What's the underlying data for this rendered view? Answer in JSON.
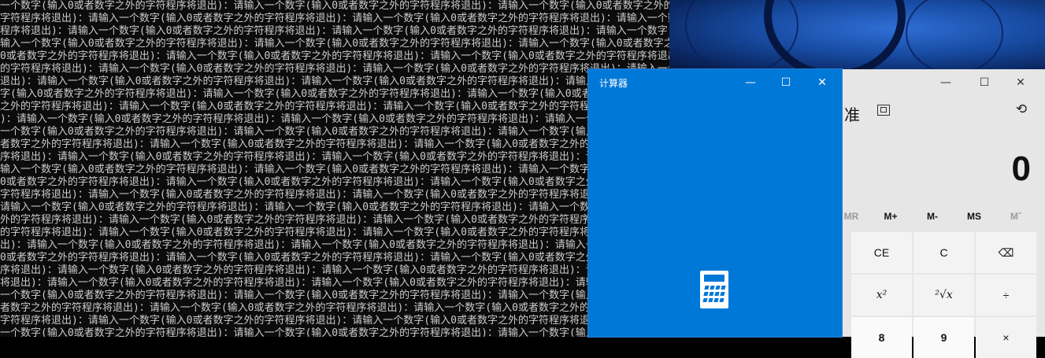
{
  "console": {
    "segment": "请输入一个数字(输入0或者数字之外的字符程序将退出)：",
    "lines": [
      "一个数字(输入0或者数字之外的字符程序将退出)：请输入一个数字(输入0或者数字之外的字符程序将退出)：请输入一个数字(输入0或者数字之外的字符程序将退出)：请",
      "字符程序将退出)：请输入一个数字(输入0或者数字之外的字符程序将退出)：请输入一个数字(输入0或者数字之外的字符程序将退出)：请输入一个数字(输入0或者",
      "程序将退出)：请输入一个数字(输入0或者数字之外的字符程序将退出)：请输入一个数字(输入0或者数字之外的字符程序将退出)：请输入一个数字(输入0或者数字之外的",
      "输入一个数字(输入0或者数字之外的字符程序将退出)：请输入一个数字(输入0或者数字之外的字符程序将退出)：请输入一个数字(输入0或者数字之外的字符程序将退出)：请",
      "0或者数字之外的字符程序将退出)：请输入一个数字(输入0或者数字之外的字符程序将退出)：请输入一个数字(输入0或者数字之外的字符程序将退出)：请输入一个数字(输",
      "的字符程序将退出)：请输入一个数字(输入0或者数字之外的字符程序将退出)：请输入一个数字(输入0或者数字之外的字符程序将退出)：请输入一个数字(输入0或者数字",
      "退出)：请输入一个数字(输入0或者数字之外的字符程序将退出)：请输入一个数字(输入0或者数字之外的字符程序将退出)：请输入一个数字(输入0或者数字之外的字",
      "字(输入0或者数字之外的字符程序将退出)：请输入一个数字(输入0或者数字之外的字符程序将退出)：请输入一个数字(输入0或者数字之外的字符程序将退出)：请输",
      "之外的字符程序将退出)：请输入一个数字(输入0或者数字之外的字符程序将退出)：请输入一个数字(输入0或者数字之外的字符程序将退出)：请输入一个数字(输入",
      ")：请输入一个数字(输入0或者数字之外的字符程序将退出)：请输入一个数字(输入0或者数字之外的字符程序将退出)：请输入一个数字(输入0或者数字之外的字",
      "一个数字(输入0或者数字之外的字符程序将退出)：请输入一个数字(输入0或者数字之外的字符程序将退出)：请输入一个数字(输入0或者数字之外的字符程序",
      "者数字之外的字符程序将退出)：请输入一个数字(输入0或者数字之外的字符程序将退出)：请输入一个数字(输入0或者数字之外的字符程序将退出)：请输入一",
      "序将退出)：请输入一个数字(输入0或者数字之外的字符程序将退出)：请输入一个数字(输入0或者数字之外的字符程序将退出)：请输入一个数字(输入0或者数",
      "输入一个数字(输入0或者数字之外的字符程序将退出)：请输入一个数字(输入0或者数字之外的字符程序将退出)：请输入一个数字(输入0或者数字之外的字符",
      "0或者数字之外的字符程序将退出)：请输入一个数字(输入0或者数字之外的字符程序将退出)：请输入一个数字(输入0或者数字之外的字符程序将退出)：请输入一",
      "字符程序将退出)：请输入一个数字(输入0或者数字之外的字符程序将退出)：请输入一个数字(输入0或者数字之外的字符程序将退出)：请输入一个数字(输入0或",
      "请输入一个数字(输入0或者数字之外的字符程序将退出)：请输入一个数字(输入0或者数字之外的字符程序将退出)：请输入一个数字(输入0或者数字之外的字符",
      "外的字符程序将退出)：请输入一个数字(输入0或者数字之外的字符程序将退出)：请输入一个数字(输入0或者数字之外的字符程序将退出)：请输入一个数",
      "的字符程序将退出)：请输入一个数字(输入0或者数字之外的字符程序将退出)：请输入一个数字(输入0或者数字之外的字符程序将退出)：请输入一个数字(输",
      "出)：请输入一个数字(输入0或者数字之外的字符程序将退出)：请输入一个数字(输入0或者数字之外的字符程序将退出)：请输入一个数字(输入0或者数字之外",
      "0或者数字之外的字符程序将退出)：请输入一个数字(输入0或者数字之外的字符程序将退出)：请输入一个数字(输入0或者数字之外的字符程序将退出)：请输入",
      "序将退出)：请输入一个数字(输入0或者数字之外的字符程序将退出)：请输入一个数字(输入0或者数字之外的字符程序将退出)：请输入一个数字(输入0或者数",
      "将退出)：请输入一个数字(输入0或者数字之外的字符程序将退出)：请输入一个数字(输入0或者数字之外的字符程序将退出)：请输入一个数字(输入0或者数字之",
      "一个数字(输入0或者数字之外的字符程序将退出)：请输入一个数字(输入0或者数字之外的字符程序将退出)：请输入一个数字(输入0或者数字之外的字符",
      "者数字之外的字符程序将退出)：请输入一个数字(输入0或者数字之外的字符程序将退出)：请输入一个数字(输入0或者数字之外的字符程序将退出)：请输入",
      "字符程序将退出)：请输入一个数字(输入0或者数字之外的字符程序将退出)：请输入一个数字(输入0或者数字之外的字符程序将退出)：请输入一个数字(输入0或者",
      "一个数字(输入0或者数字之外的字符程序将退出)：请输入一个数字(输入0或者数字之外的字符程序将退出)：请输入一个数字(输入0或者数字之外的字"
    ]
  },
  "splash": {
    "title": "计算器",
    "minimize": "—",
    "maximize": "☐",
    "close": "✕",
    "icon": "calculator-icon",
    "color": "#0078d7"
  },
  "calculator": {
    "minimize": "—",
    "maximize": "☐",
    "close": "✕",
    "mode": "准",
    "keep_on_top_icon": "keep-on-top-icon",
    "history_icon": "history-icon",
    "history_glyph": "⟲",
    "display": "0",
    "memory": [
      "MR",
      "M+",
      "M-",
      "MS",
      "Mˇ"
    ],
    "keys_row1": [
      "CE",
      "C",
      "⌫"
    ],
    "keys_row2": [
      "x²",
      "²√x",
      "÷"
    ],
    "keys_row3": [
      "8",
      "9",
      "×"
    ]
  }
}
